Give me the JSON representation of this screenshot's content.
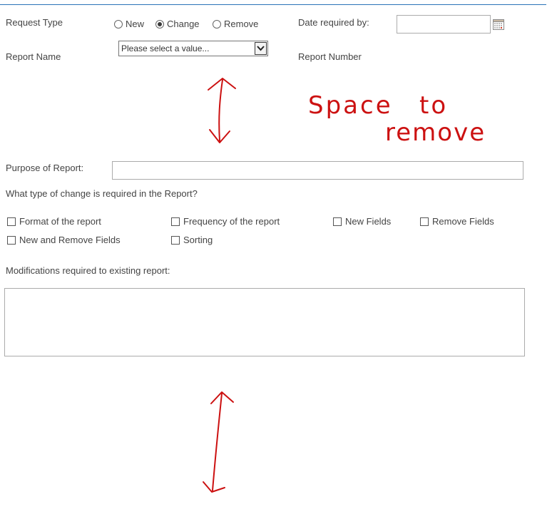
{
  "request_type": {
    "label": "Request Type",
    "options": [
      {
        "label": "New",
        "checked": false
      },
      {
        "label": "Change",
        "checked": true
      },
      {
        "label": "Remove",
        "checked": false
      }
    ]
  },
  "date_required": {
    "label": "Date required by:",
    "value": "",
    "icon": "calendar-icon"
  },
  "report_name": {
    "label": "Report Name",
    "selected": "Please select a value..."
  },
  "report_number": {
    "label": "Report Number"
  },
  "annotation": {
    "line1": "Space",
    "line2": "to",
    "line3": "remove",
    "color": "#cc1111"
  },
  "purpose": {
    "label": "Purpose of Report:",
    "value": ""
  },
  "change_type": {
    "label": "What type of change is required in the Report?",
    "options": [
      {
        "label": "Format of the report",
        "checked": false
      },
      {
        "label": "Frequency of the report",
        "checked": false
      },
      {
        "label": "New Fields",
        "checked": false
      },
      {
        "label": "Remove Fields",
        "checked": false
      },
      {
        "label": "New and Remove Fields",
        "checked": false
      },
      {
        "label": "Sorting",
        "checked": false
      }
    ]
  },
  "modifications": {
    "label": "Modifications required to existing report:",
    "value": ""
  },
  "colors": {
    "accent_line": "#2a72b8",
    "border": "#ababab",
    "text": "#444444",
    "annotation_red": "#cc1111"
  }
}
